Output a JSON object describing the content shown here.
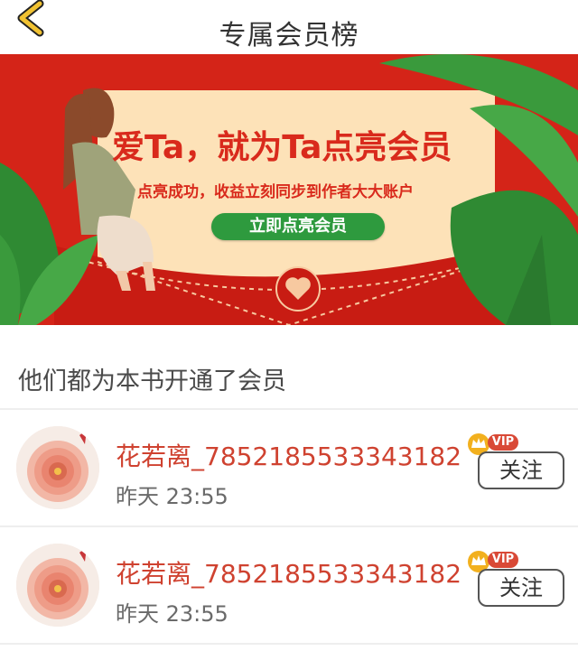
{
  "header": {
    "title": "专属会员榜",
    "back_icon": "chevron-left-icon"
  },
  "banner": {
    "title": "爱Ta，就为Ta点亮会员",
    "subtitle": "点亮成功，收益立刻同步到作者大大账户",
    "cta_label": "立即点亮会员",
    "colors": {
      "background": "#d42418",
      "card": "#fde2b8",
      "accent_text": "#d92a1c",
      "button": "#2e9a3e",
      "leaf": "#3a9a3c"
    }
  },
  "section": {
    "title": "他们都为本书开通了会员"
  },
  "members": [
    {
      "name": "花若离_7852185533343182",
      "time": "昨天 23:55",
      "badge": "VIP",
      "follow_label": "关注",
      "avatar_icon": "flower-avatar"
    },
    {
      "name": "花若离_7852185533343182",
      "time": "昨天 23:55",
      "badge": "VIP",
      "follow_label": "关注",
      "avatar_icon": "flower-avatar"
    }
  ],
  "colors": {
    "name": "#cf4230",
    "vip_badge": "#d94936",
    "crown": "#f2b01e",
    "back_arrow": "#f1c232"
  }
}
